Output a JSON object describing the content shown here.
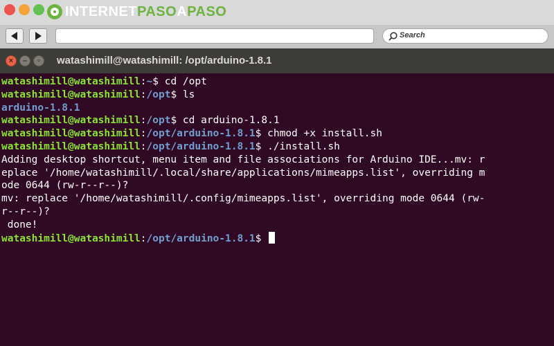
{
  "browser": {
    "logo_text_a": "INTERNET",
    "logo_text_b": "PASO",
    "logo_text_c": "A",
    "logo_text_d": "PASO",
    "search_placeholder": "Search"
  },
  "terminal": {
    "title": "watashimill@watashimill: /opt/arduino-1.8.1",
    "lines": [
      {
        "type": "prompt",
        "user": "watashimill@watashimill",
        "path": "~",
        "cmd": " cd /opt"
      },
      {
        "type": "prompt",
        "user": "watashimill@watashimill",
        "path": "/opt",
        "cmd": " ls"
      },
      {
        "type": "dir",
        "text": "arduino-1.8.1"
      },
      {
        "type": "prompt",
        "user": "watashimill@watashimill",
        "path": "/opt",
        "cmd": " cd arduino-1.8.1"
      },
      {
        "type": "prompt",
        "user": "watashimill@watashimill",
        "path": "/opt/arduino-1.8.1",
        "cmd": " chmod +x install.sh"
      },
      {
        "type": "prompt",
        "user": "watashimill@watashimill",
        "path": "/opt/arduino-1.8.1",
        "cmd": " ./install.sh"
      },
      {
        "type": "output",
        "text": "Adding desktop shortcut, menu item and file associations for Arduino IDE...mv: r"
      },
      {
        "type": "output",
        "text": "eplace '/home/watashimill/.local/share/applications/mimeapps.list', overriding m"
      },
      {
        "type": "output",
        "text": "ode 0644 (rw-r--r--)?"
      },
      {
        "type": "output",
        "text": "mv: replace '/home/watashimill/.config/mimeapps.list', overriding mode 0644 (rw-"
      },
      {
        "type": "output",
        "text": "r--r--)?"
      },
      {
        "type": "output",
        "text": " done!"
      },
      {
        "type": "prompt",
        "user": "watashimill@watashimill",
        "path": "/opt/arduino-1.8.1",
        "cmd": " ",
        "cursor": true
      }
    ],
    "colors": {
      "background": "#300a24",
      "user": "#8ae234",
      "path": "#729fcf",
      "text": "#ffffff"
    }
  }
}
